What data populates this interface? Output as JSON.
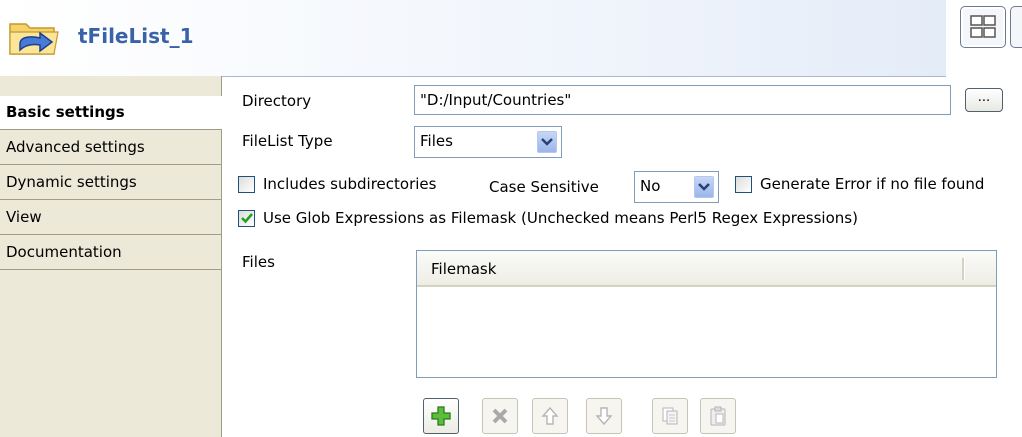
{
  "header": {
    "title": "tFileList_1",
    "icon": "folder-arrow-icon",
    "layout_button_icon": "grid-layout-icon"
  },
  "tabs": [
    {
      "label": "Basic settings",
      "active": true
    },
    {
      "label": "Advanced settings",
      "active": false
    },
    {
      "label": "Dynamic settings",
      "active": false
    },
    {
      "label": "View",
      "active": false
    },
    {
      "label": "Documentation",
      "active": false
    }
  ],
  "form": {
    "directory_label": "Directory",
    "directory_value": "\"D:/Input/Countries\"",
    "browse_label": "...",
    "filelist_type_label": "FileList Type",
    "filelist_type_value": "Files",
    "includes_subdirs_label": "Includes subdirectories",
    "includes_subdirs_checked": false,
    "case_sensitive_label": "Case Sensitive",
    "case_sensitive_value": "No",
    "generate_error_label": "Generate Error if no file found",
    "generate_error_checked": false,
    "use_glob_label": "Use Glob Expressions as Filemask (Unchecked means Perl5 Regex Expressions)",
    "use_glob_checked": true,
    "files_label": "Files",
    "table_columns": [
      "Filemask"
    ],
    "table_rows": []
  },
  "toolbar": {
    "buttons": [
      {
        "name": "add-icon",
        "enabled": true
      },
      {
        "name": "delete-icon",
        "enabled": false
      },
      {
        "name": "move-up-icon",
        "enabled": false
      },
      {
        "name": "move-down-icon",
        "enabled": false
      },
      {
        "name": "copy-icon",
        "enabled": false
      },
      {
        "name": "paste-icon",
        "enabled": false
      }
    ]
  },
  "colors": {
    "title": "#3a62a8",
    "tab_background": "#ece9d8",
    "input_border": "#7f9db9",
    "add_green": "#3a9a2a"
  }
}
